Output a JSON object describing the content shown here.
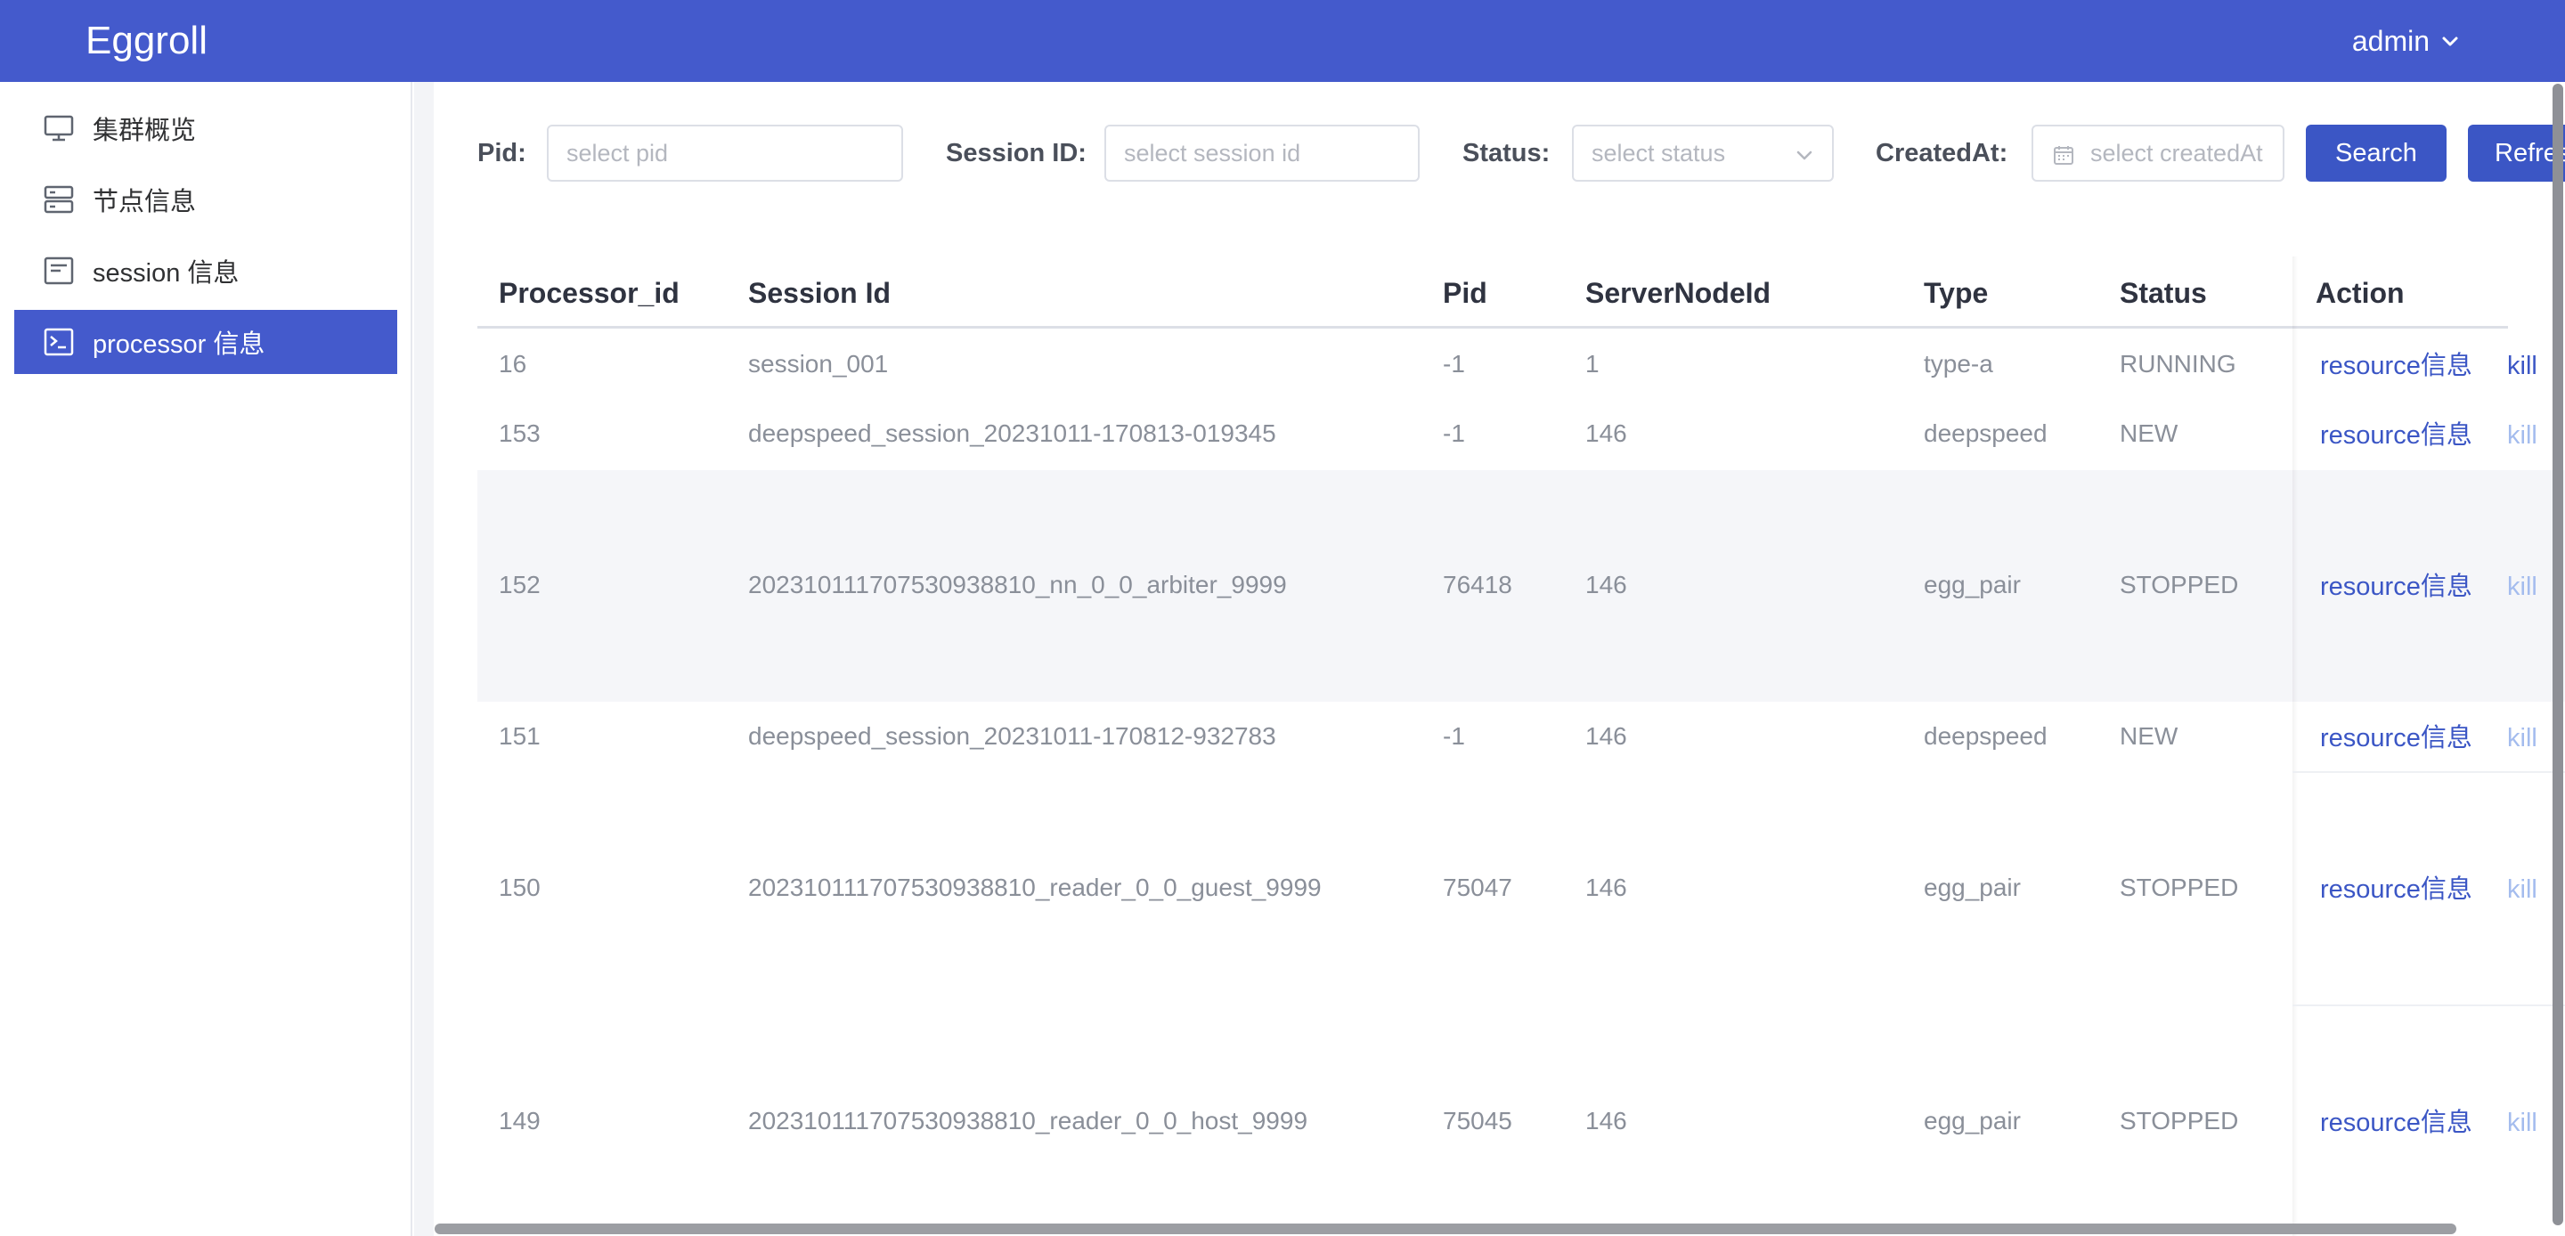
{
  "header": {
    "app_title": "Eggroll",
    "user": "admin"
  },
  "sidebar": {
    "items": [
      {
        "label": "集群概览",
        "icon": "monitor-icon"
      },
      {
        "label": "节点信息",
        "icon": "server-icon"
      },
      {
        "label": "session 信息",
        "icon": "window-icon"
      },
      {
        "label": "processor 信息",
        "icon": "terminal-icon",
        "active": true
      }
    ]
  },
  "filters": {
    "pid_label": "Pid:",
    "pid_placeholder": "select pid",
    "session_label": "Session ID:",
    "session_placeholder": "select session id",
    "status_label": "Status:",
    "status_placeholder": "select status",
    "created_label": "CreatedAt:",
    "created_placeholder": "select createdAt",
    "search_button": "Search",
    "refresh_button": "Refresh"
  },
  "table": {
    "columns": [
      "Processor_id",
      "Session Id",
      "Pid",
      "ServerNodeId",
      "Type",
      "Status",
      "Action"
    ],
    "rows": [
      {
        "processor_id": "16",
        "session_id": "session_001",
        "pid": "-1",
        "server_node_id": "1",
        "type": "type-a",
        "status": "RUNNING",
        "action_resource": "resource信息",
        "action_kill": "kill"
      },
      {
        "processor_id": "153",
        "session_id": "deepspeed_session_20231011-170813-019345",
        "pid": "-1",
        "server_node_id": "146",
        "type": "deepspeed",
        "status": "NEW",
        "action_resource": "resource信息",
        "action_kill": "kill"
      },
      {
        "processor_id": "152",
        "session_id": "202310111707530938810_nn_0_0_arbiter_9999",
        "pid": "76418",
        "server_node_id": "146",
        "type": "egg_pair",
        "status": "STOPPED",
        "action_resource": "resource信息",
        "action_kill": "kill"
      },
      {
        "processor_id": "151",
        "session_id": "deepspeed_session_20231011-170812-932783",
        "pid": "-1",
        "server_node_id": "146",
        "type": "deepspeed",
        "status": "NEW",
        "action_resource": "resource信息",
        "action_kill": "kill"
      },
      {
        "processor_id": "150",
        "session_id": "202310111707530938810_reader_0_0_guest_9999",
        "pid": "75047",
        "server_node_id": "146",
        "type": "egg_pair",
        "status": "STOPPED",
        "action_resource": "resource信息",
        "action_kill": "kill"
      },
      {
        "processor_id": "149",
        "session_id": "202310111707530938810_reader_0_0_host_9999",
        "pid": "75045",
        "server_node_id": "146",
        "type": "egg_pair",
        "status": "STOPPED",
        "action_resource": "resource信息",
        "action_kill": "kill"
      }
    ]
  },
  "colors": {
    "primary": "#445acc",
    "button": "#3b56c5",
    "kill_disabled": "#a4bcee",
    "row_highlight": "#f5f6f9"
  }
}
